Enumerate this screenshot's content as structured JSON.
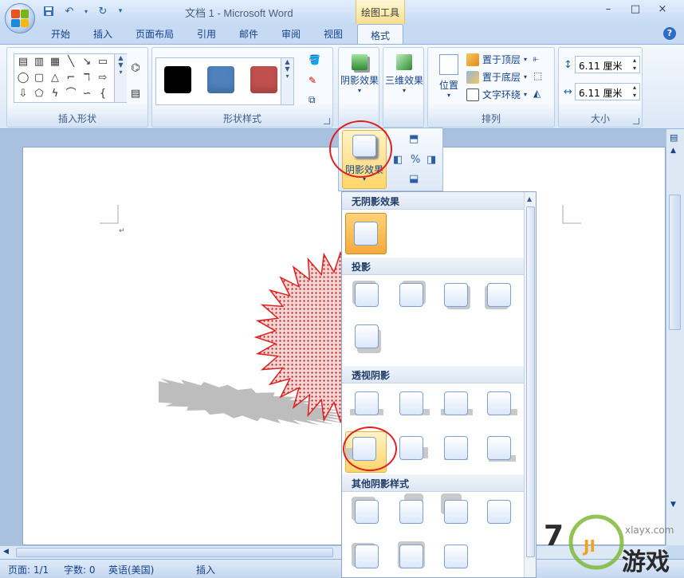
{
  "window": {
    "title": "文档 1 - Microsoft Word",
    "context_tab_group": "绘图工具",
    "controls": [
      "–",
      "□",
      "×"
    ]
  },
  "tabs": [
    "开始",
    "插入",
    "页面布局",
    "引用",
    "邮件",
    "审阅",
    "视图"
  ],
  "active_tab": "格式",
  "ribbon": {
    "insert_shapes": {
      "label": "插入形状"
    },
    "shape_styles": {
      "label": "形状样式",
      "swatches": [
        "#000000",
        "#4f81bd",
        "#c0504d"
      ]
    },
    "shadow_effects": {
      "label": "阴影效果"
    },
    "three_d": {
      "label": "三维效果"
    },
    "arrange": {
      "label": "排列",
      "position": "位置",
      "bring_front": "置于顶层",
      "send_back": "置于底层",
      "wrap_text": "文字环绕"
    },
    "size": {
      "label": "大小",
      "height": "6.11 厘米",
      "width": "6.11 厘米"
    }
  },
  "shadow_popup": {
    "button_label": "阴影效果"
  },
  "shadow_menu": {
    "no_shadow": "无阴影效果",
    "drop_shadow": "投影",
    "perspective_shadow": "透视阴影",
    "other_styles": "其他阴影样式"
  },
  "status": {
    "page": "页面: 1/1",
    "words": "字数: 0",
    "language": "英语(美国)",
    "mode": "插入"
  },
  "watermark": {
    "site": "xlayx.com",
    "brand": "游戏"
  },
  "colors": {
    "accent_orange": "#f6a93b",
    "burst_red": "#e02020",
    "ribbon_blue": "#c6daf3"
  }
}
